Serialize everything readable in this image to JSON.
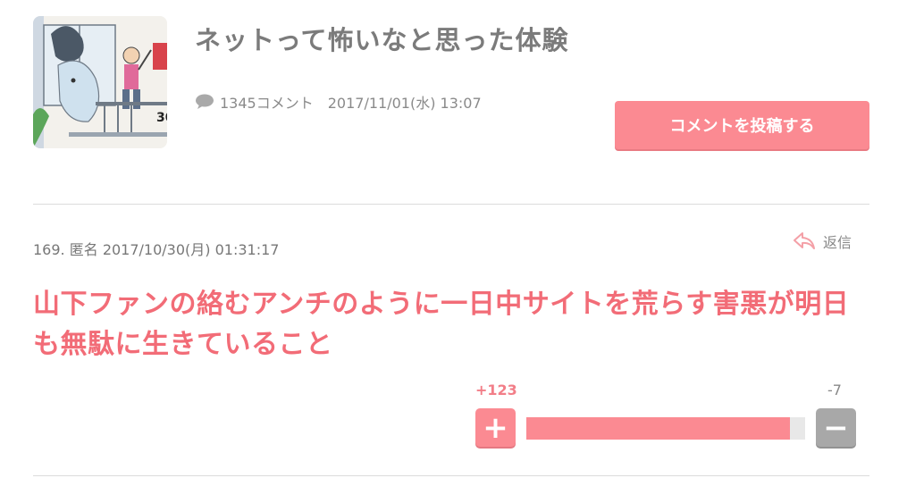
{
  "topic": {
    "title": "ネットって怖いなと思った体験",
    "comment_count": "1345コメント",
    "date": "2017/11/01(水) 13:07",
    "post_button": "コメントを投稿する",
    "thumbnail_price_fragment": "30"
  },
  "comment": {
    "number_and_author": "169. 匿名",
    "timestamp": "2017/10/30(月) 01:31:17",
    "reply_label": "返信",
    "body": "山下ファンの絡むアンチのように一日中サイトを荒らす害悪が明日も無駄に生きていること",
    "plus_count": "+123",
    "minus_count": "-7",
    "plus_symbol": "+",
    "minus_symbol": "−",
    "plus_value": 123,
    "minus_value": 7
  },
  "colors": {
    "accent": "#fb8a92",
    "comment_text": "#f26c77",
    "title_text": "#7b7b7b",
    "minus_button": "#a8a8a8"
  },
  "icons": {
    "comment": "speech-bubble-icon",
    "reply": "reply-arrow-icon"
  }
}
